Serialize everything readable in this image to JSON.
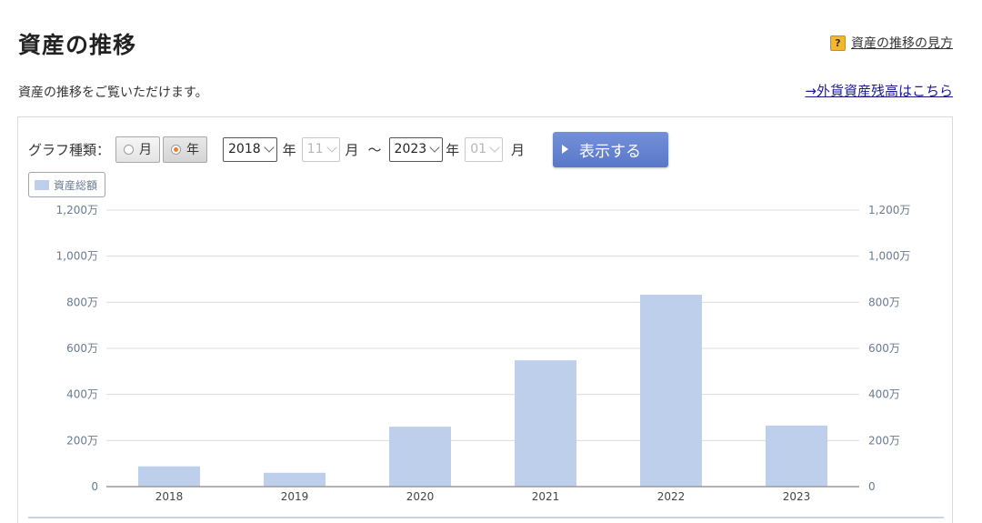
{
  "header": {
    "title": "資産の推移",
    "help_icon_glyph": "?",
    "help_link": "資産の推移の見方",
    "lead": "資産の推移をご覧いただけます。",
    "fx_link": "→外貨資産残高はこちら"
  },
  "controls": {
    "graph_type_label": "グラフ種類：",
    "radio_month": "月",
    "radio_year": "年",
    "selected": "年",
    "from_year": "2018",
    "from_month": "11",
    "to_year": "2023",
    "to_month": "01",
    "year_unit": "年",
    "month_unit": "月",
    "tilde": "〜",
    "show_button": "表示する"
  },
  "colors": {
    "bar": "#bdcfeb",
    "button": "#6482d0",
    "axis_text": "#6a7a90"
  },
  "chart_data": {
    "type": "bar",
    "categories": [
      "2018",
      "2019",
      "2020",
      "2021",
      "2022",
      "2023"
    ],
    "series": [
      {
        "name": "資産総額",
        "values": [
          880000,
          600000,
          2600000,
          5480000,
          8330000,
          2650000
        ]
      }
    ],
    "ylim": [
      0,
      12000000
    ],
    "yticks": [
      0,
      2000000,
      4000000,
      6000000,
      8000000,
      10000000,
      12000000
    ],
    "ytick_labels": [
      "0",
      "200万",
      "400万",
      "600万",
      "800万",
      "1,000万",
      "1,200万"
    ],
    "xlabel": "",
    "ylabel": "",
    "grid": true,
    "legend": "top-left"
  }
}
